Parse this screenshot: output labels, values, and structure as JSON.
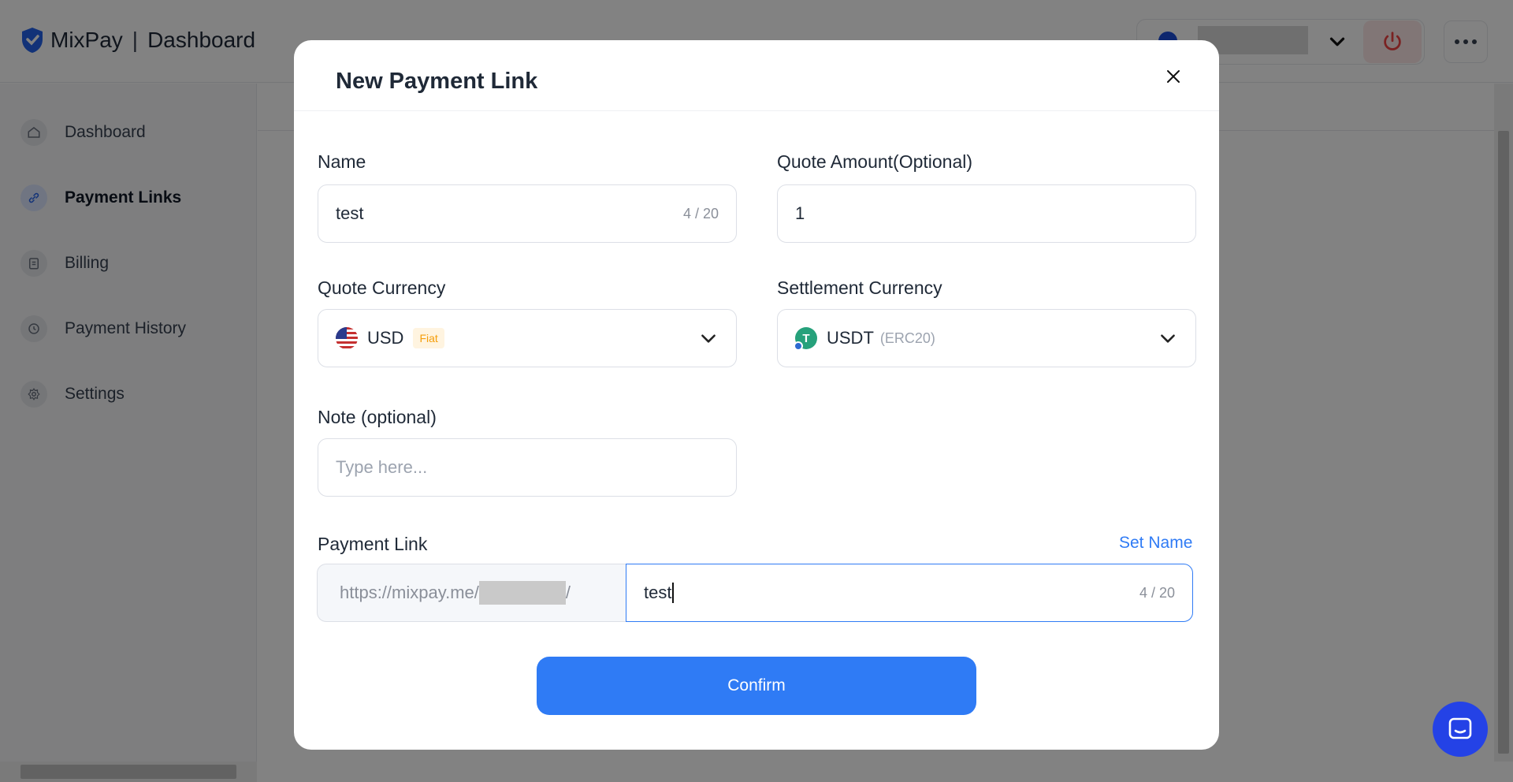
{
  "header": {
    "brand": "MixPay",
    "separator": "|",
    "section": "Dashboard"
  },
  "sidebar": {
    "items": [
      {
        "label": "Dashboard",
        "icon": "home-icon"
      },
      {
        "label": "Payment Links",
        "icon": "link-icon",
        "active": true
      },
      {
        "label": "Billing",
        "icon": "clipboard-icon"
      },
      {
        "label": "Payment History",
        "icon": "history-icon"
      },
      {
        "label": "Settings",
        "icon": "gear-icon"
      }
    ]
  },
  "modal": {
    "title": "New Payment Link",
    "name": {
      "label": "Name",
      "value": "test",
      "count": "4 / 20"
    },
    "quote_amount": {
      "label": "Quote Amount(Optional)",
      "value": "1"
    },
    "quote_currency": {
      "label": "Quote Currency",
      "value": "USD",
      "badge": "Fiat",
      "icon": "us-flag-icon"
    },
    "settlement_currency": {
      "label": "Settlement Currency",
      "value": "USDT",
      "network": "(ERC20)",
      "icon": "tether-icon",
      "icon_letter": "T"
    },
    "note": {
      "label": "Note (optional)",
      "placeholder": "Type here..."
    },
    "payment_link": {
      "label": "Payment Link",
      "set_name": "Set Name",
      "prefix_start": "https://mixpay.me/",
      "prefix_end": "/",
      "value": "test",
      "count": "4 / 20"
    },
    "confirm_label": "Confirm"
  },
  "colors": {
    "accent": "#2f7bf5",
    "overlay": "rgba(0,0,0,0.49)",
    "fiat_badge": "#f59e0b",
    "tether": "#26a17b",
    "chat": "#2442e6"
  }
}
